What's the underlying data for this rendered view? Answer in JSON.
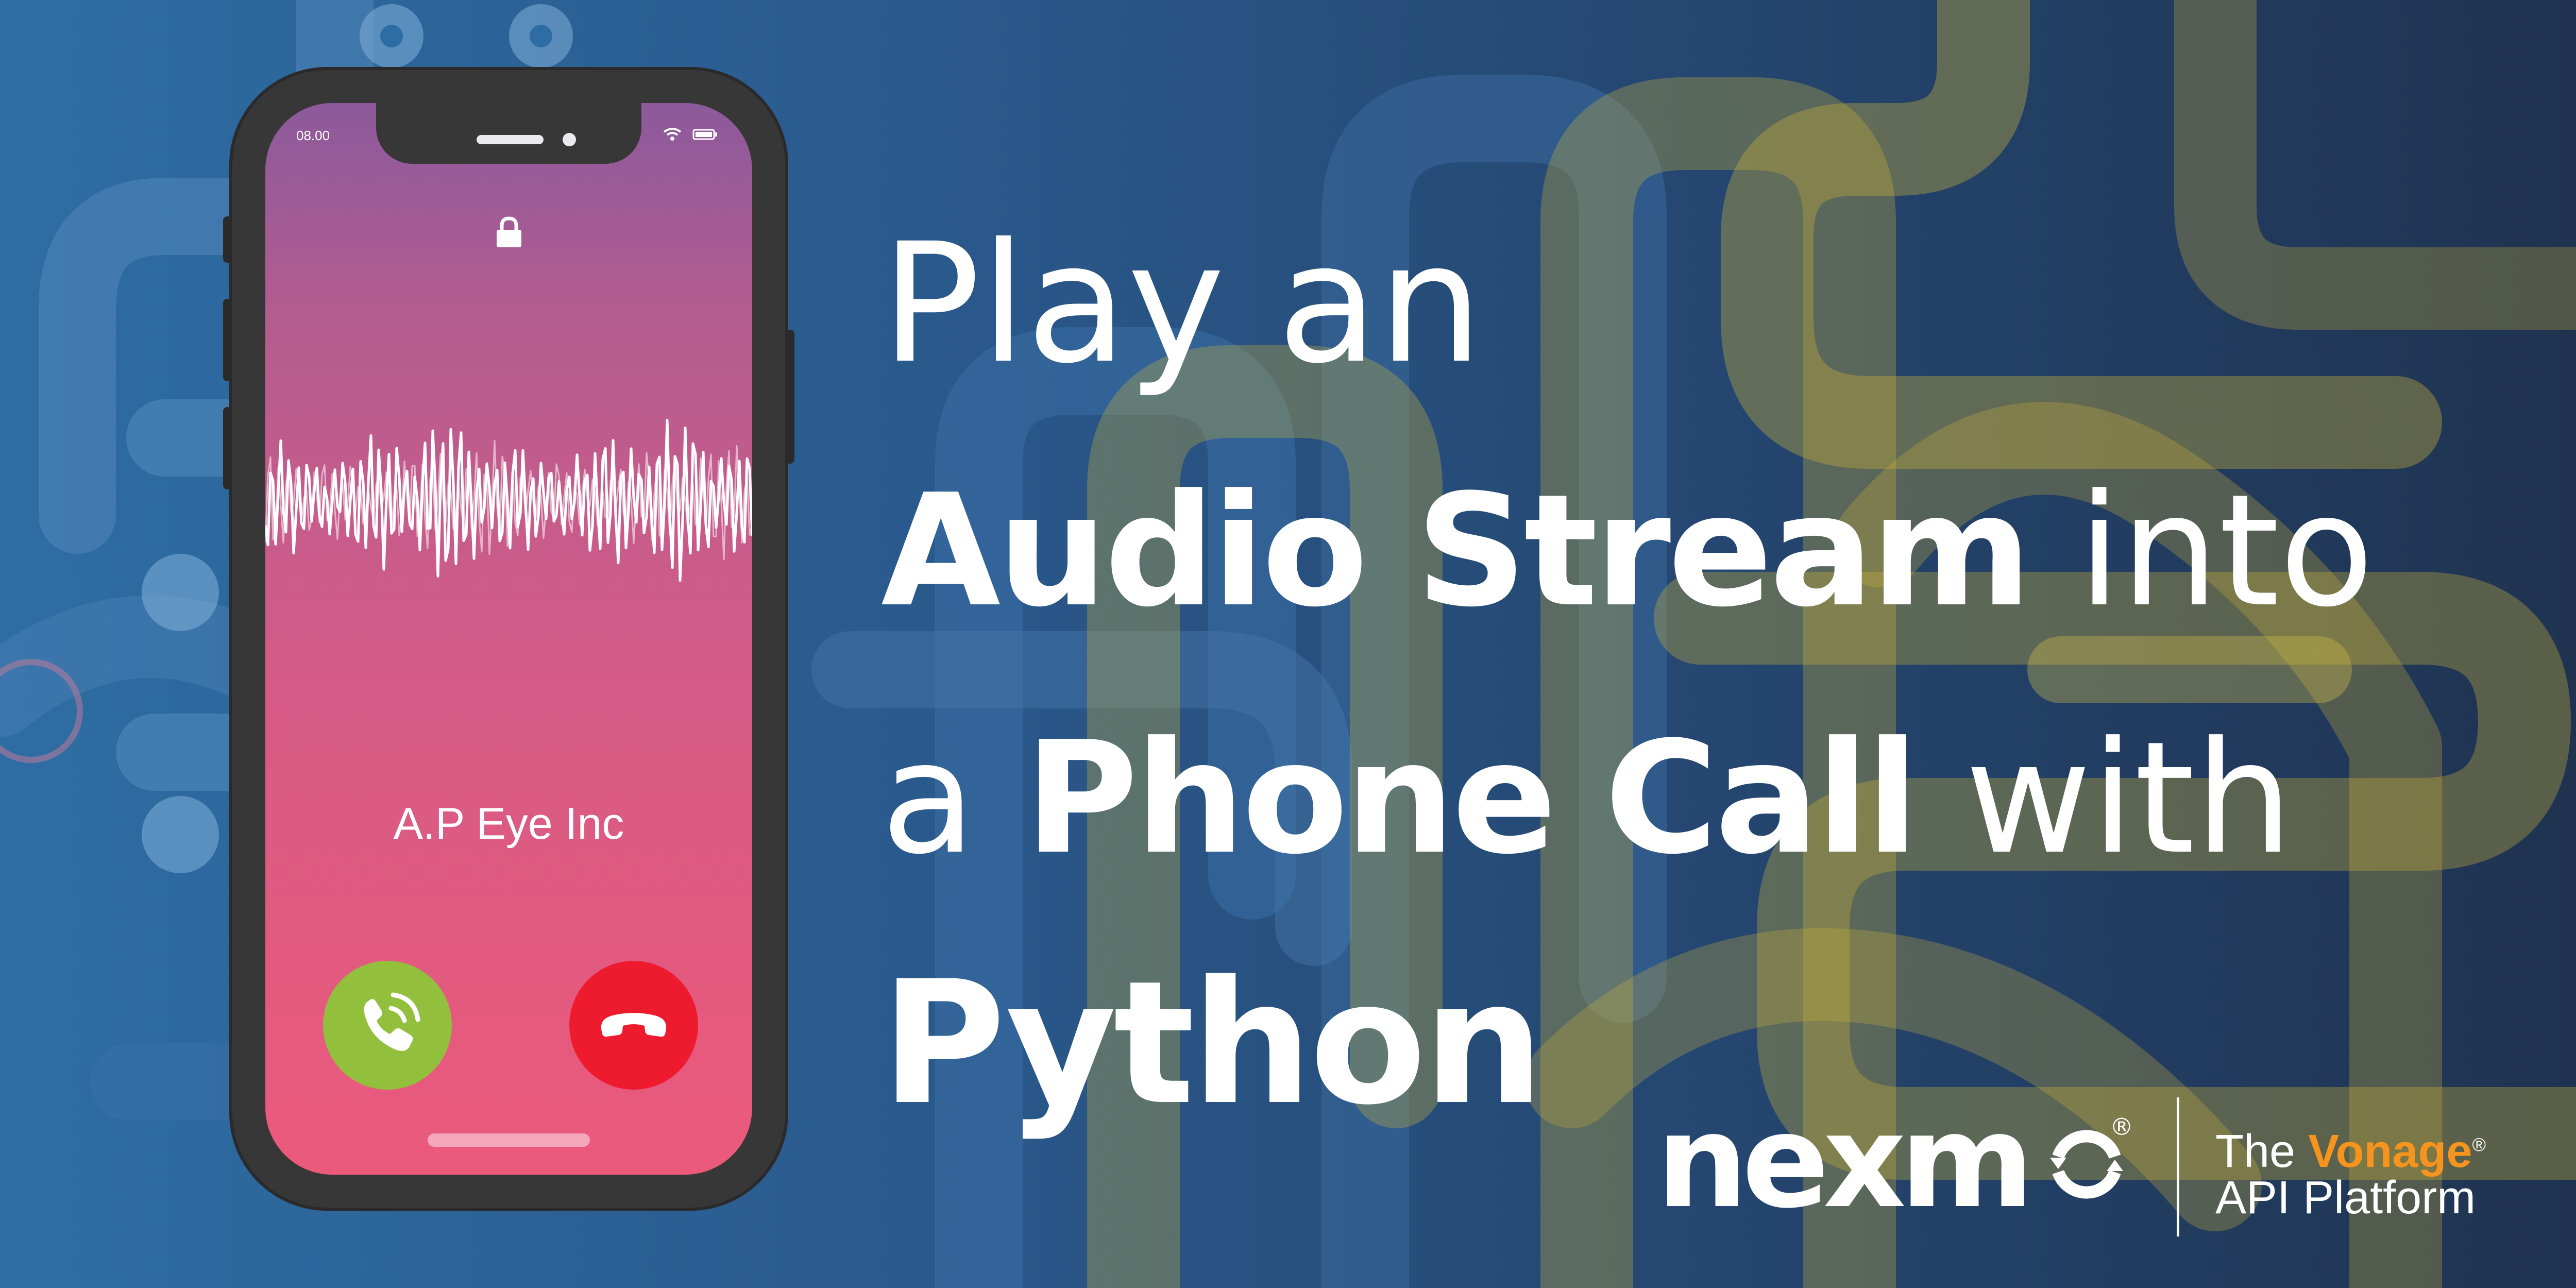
{
  "headline": {
    "line1": "Play an",
    "line2_bold": "Audio Stream",
    "line2_light": " into",
    "line3_light": "a ",
    "line3_bold": "Phone Call",
    "line3_light_end": " with",
    "line4_bold": "Python"
  },
  "phone": {
    "time": "08.00",
    "caller_name": "A.P Eye Inc",
    "icons": [
      "wifi-icon",
      "battery-icon",
      "lock-icon",
      "answer-phone-icon",
      "decline-phone-icon"
    ],
    "colors": {
      "answer": "#92c03c",
      "decline": "#ee1b2f"
    }
  },
  "logo": {
    "brand": "nexm",
    "registered": "®",
    "tagline_prefix": "The ",
    "tagline_brand": "Vonage",
    "tagline_brand_reg": "®",
    "tagline_line2": "API Platform"
  },
  "colors": {
    "background_left": "#2e6da3",
    "background_right": "#1f3350",
    "accent_orange": "#f7941d",
    "pipe_yellow": "#c9b13a"
  }
}
